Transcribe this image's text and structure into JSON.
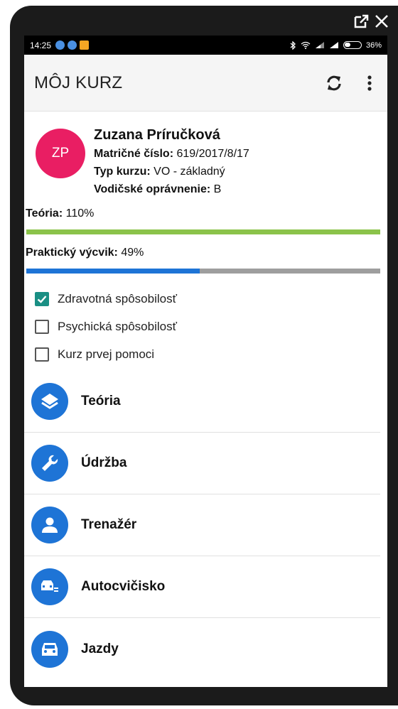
{
  "window": {
    "popout_icon": "external-window-icon",
    "close_icon": "close-icon"
  },
  "status_bar": {
    "time": "14:25",
    "battery": "36%",
    "icons": [
      "notification-icon",
      "notification-icon",
      "notification-icon",
      "bluetooth-icon",
      "wifi-icon",
      "signal-icon",
      "signal-icon",
      "battery-icon"
    ]
  },
  "app_bar": {
    "title": "MÔJ KURZ",
    "refresh_icon": "refresh-icon",
    "more_icon": "more-vert-icon"
  },
  "profile": {
    "initials": "ZP",
    "avatar_color": "#e91e63",
    "name": "Zuzana Príručková",
    "matricne_label": "Matričné číslo:",
    "matricne_value": "619/2017/8/17",
    "typ_label": "Typ kurzu:",
    "typ_value": "VO - základný",
    "opravnenie_label": "Vodičské oprávnenie:",
    "opravnenie_value": "B"
  },
  "progress": {
    "teoria_label": "Teória:",
    "teoria_value": "110%",
    "teoria_fraction": 1.0,
    "teoria_color": "#8bc34a",
    "prax_label": "Praktický výcvik:",
    "prax_value": "49%",
    "prax_fraction": 0.49,
    "prax_color": "#1e74d6"
  },
  "checklist": [
    {
      "label": "Zdravotná spôsobilosť",
      "checked": true
    },
    {
      "label": "Psychická spôsobilosť",
      "checked": false
    },
    {
      "label": "Kurz prvej pomoci",
      "checked": false
    }
  ],
  "menu": [
    {
      "label": "Teória",
      "icon": "layers-icon"
    },
    {
      "label": "Údržba",
      "icon": "wrench-icon"
    },
    {
      "label": "Trenažér",
      "icon": "person-icon"
    },
    {
      "label": "Autocvičisko",
      "icon": "car-parking-icon"
    },
    {
      "label": "Jazdy",
      "icon": "car-icon"
    }
  ],
  "accent_color": "#1e74d6",
  "checkbox_color": "#1a8f84"
}
